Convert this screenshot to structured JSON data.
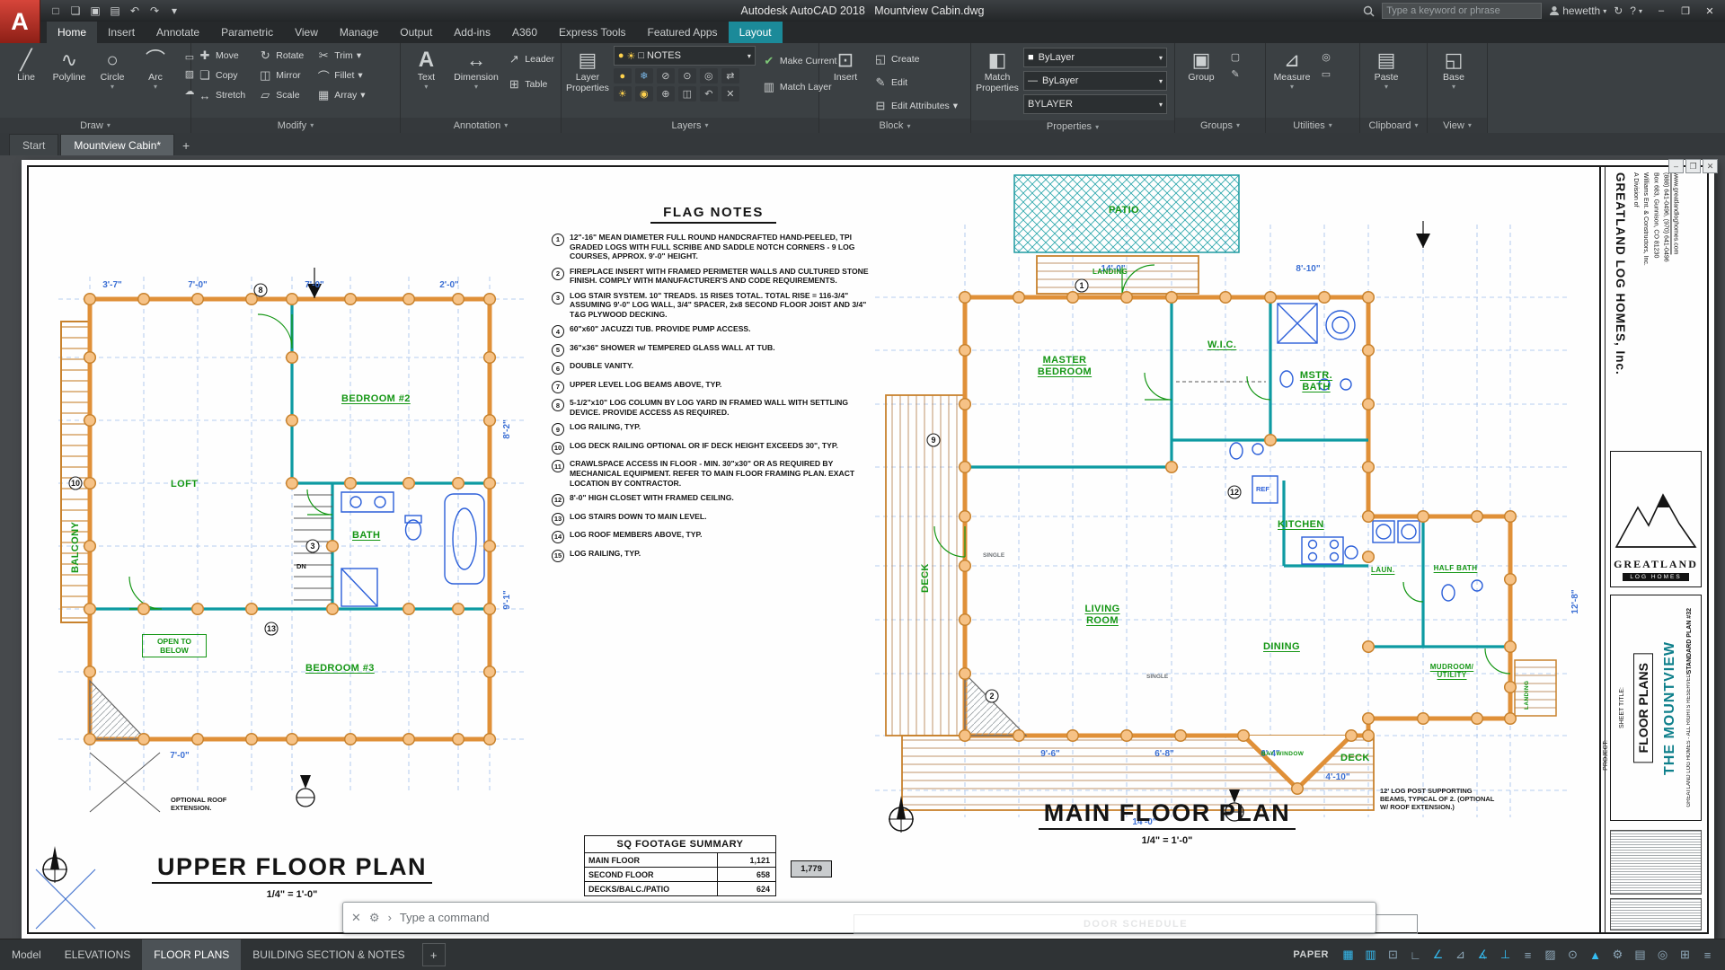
{
  "icons": {
    "caret_down": "▾",
    "close": "✕",
    "minimize": "–",
    "restore": "❐",
    "help": "?",
    "prompt": "›",
    "gear": "⚙",
    "plus": "+",
    "bulb": "●",
    "sun": "☀",
    "swatch_white": "□",
    "swatch": "■",
    "thick_line": "—",
    "app_letter": "A"
  },
  "titlebar": {
    "title": "Autodesk AutoCAD 2018",
    "doc": "Mountview Cabin.dwg",
    "search_placeholder": "Type a keyword or phrase",
    "user": "hewetth",
    "help": "?",
    "qat": [
      {
        "name": "new-file-icon",
        "glyph": "□"
      },
      {
        "name": "open-file-icon",
        "glyph": "❏"
      },
      {
        "name": "save-icon",
        "glyph": "▣"
      },
      {
        "name": "plot-icon",
        "glyph": "▤"
      },
      {
        "name": "undo-icon",
        "glyph": "↶"
      },
      {
        "name": "redo-icon",
        "glyph": "↷"
      },
      {
        "name": "qat-menu-icon",
        "glyph": "▾"
      }
    ]
  },
  "ribbon": {
    "tabs": [
      {
        "label": "Home",
        "cls": "active"
      },
      {
        "label": "Insert"
      },
      {
        "label": "Annotate"
      },
      {
        "label": "Parametric"
      },
      {
        "label": "View"
      },
      {
        "label": "Manage"
      },
      {
        "label": "Output"
      },
      {
        "label": "Add-ins"
      },
      {
        "label": "A360"
      },
      {
        "label": "Express Tools"
      },
      {
        "label": "Featured Apps"
      },
      {
        "label": "Layout",
        "cls": "ctx"
      }
    ],
    "draw": {
      "title": "Draw",
      "items": [
        {
          "name": "line-button",
          "glyph": "╱",
          "label": "Line"
        },
        {
          "name": "polyline-button",
          "glyph": "∿",
          "label": "Polyline"
        },
        {
          "name": "circle-button",
          "glyph": "○",
          "label": "Circle",
          "dd": "▾"
        },
        {
          "name": "arc-button",
          "glyph": "⌒",
          "label": "Arc",
          "dd": "▾"
        }
      ],
      "small": [
        {
          "name": "rectangle-tool-icon",
          "glyph": "▭"
        },
        {
          "name": "hatch-tool-icon",
          "glyph": "▨"
        },
        {
          "name": "revision-cloud-tool-icon",
          "glyph": "☁"
        }
      ]
    },
    "modify": {
      "title": "Modify",
      "items": [
        {
          "name": "move-button",
          "glyph": "✚",
          "label": "Move"
        },
        {
          "name": "rotate-button",
          "glyph": "↻",
          "label": "Rotate"
        },
        {
          "name": "trim-button",
          "glyph": "✂",
          "label": "Trim",
          "dd": "▾"
        },
        {
          "name": "copy-button",
          "glyph": "❏",
          "label": "Copy"
        },
        {
          "name": "mirror-button",
          "glyph": "◫",
          "label": "Mirror"
        },
        {
          "name": "fillet-button",
          "glyph": "⌒",
          "label": "Fillet",
          "dd": "▾"
        },
        {
          "name": "stretch-button",
          "glyph": "↔",
          "label": "Stretch"
        },
        {
          "name": "scale-button",
          "glyph": "▱",
          "label": "Scale"
        },
        {
          "name": "array-button",
          "glyph": "▦",
          "label": "Array",
          "dd": "▾"
        }
      ]
    },
    "annotation": {
      "title": "Annotation",
      "text_label": "Text",
      "dimension_label": "Dimension",
      "leader_label": "Leader",
      "table_label": "Table"
    },
    "layers": {
      "title": "Layers",
      "properties_label": "Layer Properties",
      "current_layer": "NOTES",
      "make_current": "Make Current",
      "match_layer": "Match Layer",
      "row1": [
        {
          "name": "layer-off-icon",
          "glyph": "●",
          "cls": "yl"
        },
        {
          "name": "layer-freeze-icon",
          "glyph": "❄",
          "cls": "bl"
        },
        {
          "name": "layer-lock-icon",
          "glyph": "⊘"
        },
        {
          "name": "layer-isolate-icon",
          "glyph": "⊙"
        },
        {
          "name": "layer-unisolate-icon",
          "glyph": "◎"
        },
        {
          "name": "layer-walk-icon",
          "glyph": "⇄"
        }
      ],
      "row2": [
        {
          "name": "layer-on-icon",
          "glyph": "☀",
          "cls": "yl"
        },
        {
          "name": "layer-thaw-icon",
          "glyph": "◉",
          "cls": "yl"
        },
        {
          "name": "layer-unlock-icon",
          "glyph": "⊕"
        },
        {
          "name": "layer-match-icon",
          "glyph": "◫"
        },
        {
          "name": "layer-previous-icon",
          "glyph": "↶"
        },
        {
          "name": "layer-merge-icon",
          "glyph": "✕"
        }
      ]
    },
    "block": {
      "title": "Block",
      "insert_label": "Insert",
      "create_label": "Create",
      "edit_label": "Edit",
      "edit_attr_label": "Edit Attributes"
    },
    "properties": {
      "title": "Properties",
      "match_label": "Match Properties",
      "color_value": "ByLayer",
      "lineweight_value": "ByLayer",
      "linetype_value": "BYLAYER"
    },
    "groups": {
      "title": "Groups",
      "group_label": "Group"
    },
    "utilities": {
      "title": "Utilities",
      "measure_label": "Measure"
    },
    "clipboard": {
      "title": "Clipboard",
      "paste_label": "Paste"
    },
    "view_panel": {
      "title": "View",
      "base_label": "Base"
    }
  },
  "doc_tabs": {
    "items": [
      {
        "label": "Start"
      },
      {
        "label": "Mountview Cabin*",
        "cls": "active"
      }
    ]
  },
  "sheet": {
    "flag_notes": {
      "title": "FLAG NOTES",
      "items": [
        {
          "n": "1",
          "text": "12\"-16\" MEAN DIAMETER FULL ROUND HANDCRAFTED HAND-PEELED, TPI GRADED LOGS WITH FULL SCRIBE AND SADDLE NOTCH CORNERS - 9 LOG COURSES, APPROX. 9'-0\" HEIGHT."
        },
        {
          "n": "2",
          "text": "FIREPLACE INSERT WITH FRAMED PERIMETER WALLS AND CULTURED STONE FINISH. COMPLY WITH MANUFACTURER'S AND CODE REQUIREMENTS."
        },
        {
          "n": "3",
          "text": "LOG STAIR SYSTEM. 10\" TREADS. 15 RISES TOTAL. TOTAL RISE = 116-3/4\" ASSUMING 9'-0\" LOG WALL, 3/4\" SPACER, 2x8 SECOND FLOOR JOIST AND 3/4\" T&G PLYWOOD DECKING."
        },
        {
          "n": "4",
          "text": "60\"x60\" JACUZZI TUB. PROVIDE PUMP ACCESS."
        },
        {
          "n": "5",
          "text": "36\"x36\" SHOWER w/ TEMPERED GLASS WALL AT TUB."
        },
        {
          "n": "6",
          "text": "DOUBLE VANITY."
        },
        {
          "n": "7",
          "text": "UPPER LEVEL LOG BEAMS ABOVE, TYP."
        },
        {
          "n": "8",
          "text": "5-1/2\"x10\" LOG COLUMN BY LOG YARD IN FRAMED WALL WITH SETTLING DEVICE. PROVIDE ACCESS AS REQUIRED."
        },
        {
          "n": "9",
          "text": "LOG RAILING, TYP."
        },
        {
          "n": "10",
          "text": "LOG DECK RAILING OPTIONAL OR IF DECK HEIGHT EXCEEDS 30\", TYP."
        },
        {
          "n": "11",
          "text": "CRAWLSPACE ACCESS IN FLOOR - MIN. 30\"x30\" OR AS REQUIRED BY MECHANICAL EQUIPMENT. REFER TO MAIN FLOOR FRAMING PLAN. EXACT LOCATION BY CONTRACTOR."
        },
        {
          "n": "12",
          "text": "8'-0\" HIGH CLOSET WITH FRAMED CEILING."
        },
        {
          "n": "13",
          "text": "LOG STAIRS DOWN TO MAIN LEVEL."
        },
        {
          "n": "14",
          "text": "LOG ROOF MEMBERS ABOVE, TYP."
        },
        {
          "n": "15",
          "text": "LOG RAILING, TYP."
        }
      ]
    },
    "sq_footage": {
      "title": "SQ FOOTAGE SUMMARY",
      "rows": [
        [
          "MAIN FLOOR",
          "1,121"
        ],
        [
          "SECOND FLOOR",
          "658"
        ],
        [
          "DECKS/BALC./PATIO",
          "624"
        ]
      ],
      "total": "1,779"
    },
    "door_schedule": {
      "title": "DOOR SCHEDULE"
    },
    "upper_plan": {
      "title": "UPPER FLOOR PLAN",
      "scale": "1/4\" = 1'-0\"",
      "rooms": {
        "loft": "LOFT",
        "bedroom2": "BEDROOM #2",
        "bath": "BATH",
        "bedroom3": "BEDROOM #3",
        "open_below": "OPEN TO BELOW",
        "balcony": "BALCONY",
        "dn": "DN"
      },
      "notes": {
        "roof": "OPTIONAL ROOF EXTENSION."
      },
      "dims": [
        "3'-7\"",
        "7'-0\"",
        "7'-0\"",
        "2'-0\"",
        "8'-2\"",
        "9'-1\"",
        "7'-0\""
      ],
      "refs": [
        "8",
        "3",
        "10",
        "13"
      ]
    },
    "main_plan": {
      "title": "MAIN FLOOR PLAN",
      "scale": "1/4\" = 1'-0\"",
      "rooms": {
        "patio": "PATIO",
        "landing": "LANDING",
        "master": "MASTER BEDROOM",
        "wic": "W.I.C.",
        "mstr_bath": "MSTR. BATH",
        "kitchen": "KITCHEN",
        "ref": "REF",
        "living": "LIVING ROOM",
        "dining": "DINING",
        "deck_left": "DECK",
        "deck_bottom": "DECK",
        "laun": "LAUN.",
        "half_bath": "HALF BATH",
        "mudroom": "MUDROOM/ UTILITY",
        "landing_right": "LANDING",
        "bay": "BAY WINDOW",
        "single": "SINGLE"
      },
      "notes": {
        "post": "12' LOG POST SUPPORTING BEAMS, TYPICAL OF 2. (OPTIONAL W/ ROOF EXTENSION.)"
      },
      "dims": [
        "14'-0\"",
        "8'-10\"",
        "9'-6\"",
        "6'-8\"",
        "6'-4\"",
        "4'-10\"",
        "14'-0\"",
        "12'-8\""
      ],
      "refs": [
        "1",
        "2",
        "9",
        "12"
      ]
    },
    "title_block": {
      "company": "GREATLAND LOG HOMES, Inc.",
      "division": "A Division of",
      "company2": "Williams Ent. & Constructors, Inc.",
      "address": "Box 683, Gunnison, CO 81230",
      "phone": "(888) 641-0496, (970) 641-0496",
      "web": "www.greatlandloghomes.com",
      "logo_text": "GREATLAND",
      "logo_sub": "LOG HOMES",
      "sheet_title_label": "SHEET TITLE:",
      "project_label": "PROJECT:",
      "sheet_title": "FLOOR PLANS",
      "project": "THE MOUNTVIEW",
      "plan_no": "STANDARD PLAN #32",
      "rights": "GREATLAND LOG HOMES - ALL RIGHTS RESERVED"
    }
  },
  "command": {
    "prompt": "Type a command"
  },
  "bottom": {
    "layout_tabs": [
      {
        "label": "Model"
      },
      {
        "label": "ELEVATIONS"
      },
      {
        "label": "FLOOR PLANS",
        "cls": "active"
      },
      {
        "label": "BUILDING SECTION & NOTES"
      }
    ],
    "paper_label": "PAPER",
    "status_icons": [
      {
        "name": "grid-display-icon",
        "glyph": "▦",
        "cls": "on"
      },
      {
        "name": "snap-mode-icon",
        "glyph": "▥",
        "cls": "on"
      },
      {
        "name": "infer-constraints-icon",
        "glyph": "⊡"
      },
      {
        "name": "ortho-mode-icon",
        "glyph": "∟"
      },
      {
        "name": "polar-tracking-icon",
        "glyph": "∠",
        "cls": "on"
      },
      {
        "name": "isodraft-icon",
        "glyph": "⊿"
      },
      {
        "name": "object-snap-tracking-icon",
        "glyph": "∡",
        "cls": "on"
      },
      {
        "name": "object-snap-icon",
        "glyph": "⊥",
        "cls": "on"
      },
      {
        "name": "lineweight-display-icon",
        "glyph": "≡"
      },
      {
        "name": "transparency-icon",
        "glyph": "▨"
      },
      {
        "name": "selection-cycling-icon",
        "glyph": "⊙"
      },
      {
        "name": "annotation-scale-icon",
        "glyph": "▲",
        "cls": "on"
      },
      {
        "name": "workspace-switching-icon",
        "glyph": "⚙"
      },
      {
        "name": "quick-properties-icon",
        "glyph": "▤"
      },
      {
        "name": "isolate-objects-icon",
        "glyph": "◎"
      },
      {
        "name": "clean-screen-icon",
        "glyph": "⊞"
      },
      {
        "name": "customization-icon",
        "glyph": "≡"
      }
    ]
  }
}
